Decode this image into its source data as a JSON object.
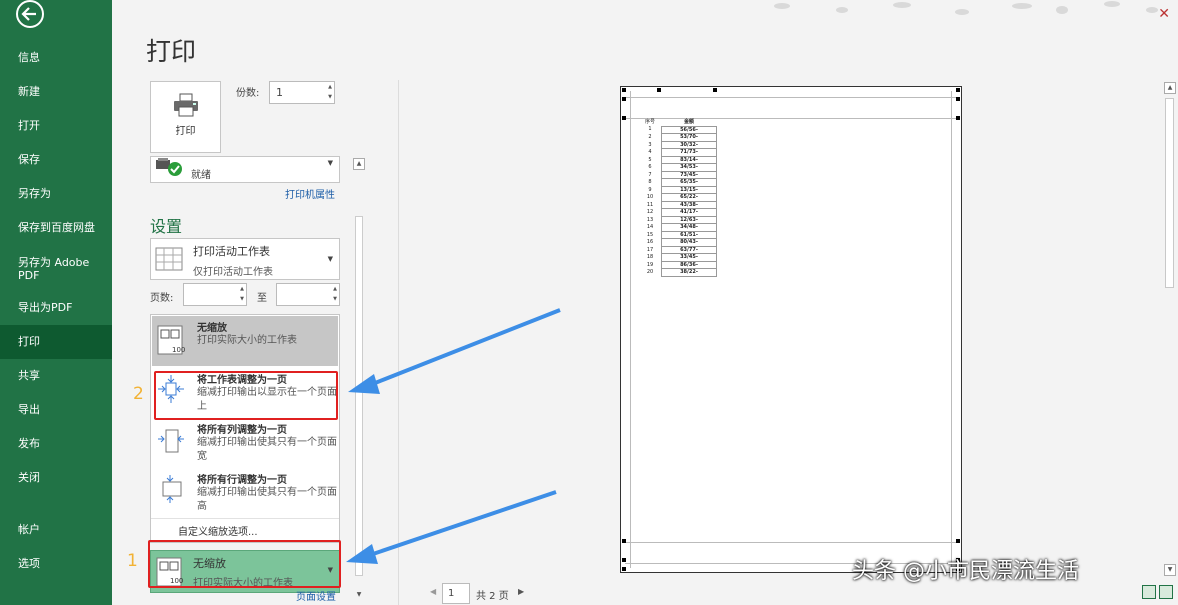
{
  "sidebar": {
    "items": [
      {
        "label": "信息"
      },
      {
        "label": "新建"
      },
      {
        "label": "打开"
      },
      {
        "label": "保存"
      },
      {
        "label": "另存为"
      },
      {
        "label": "保存到百度网盘"
      },
      {
        "label": "另存为 Adobe PDF"
      },
      {
        "label": "导出为PDF"
      },
      {
        "label": "打印"
      },
      {
        "label": "共享"
      },
      {
        "label": "导出"
      },
      {
        "label": "发布"
      },
      {
        "label": "关闭"
      },
      {
        "label": "帐户"
      },
      {
        "label": "选项"
      }
    ],
    "active": "打印",
    "colors": {
      "bg": "#217346",
      "active": "#0e5a30"
    }
  },
  "header": {
    "title": "打印"
  },
  "print": {
    "button_label": "打印",
    "copies_label": "份数:",
    "copies_value": "1"
  },
  "printer": {
    "status": "就绪",
    "properties_link": "打印机属性"
  },
  "settings": {
    "title": "设置",
    "print_what": {
      "title": "打印活动工作表",
      "desc": "仅打印活动工作表"
    },
    "pages_label": "页数:",
    "to_label": "至",
    "scaling_menu": [
      {
        "title": "无缩放",
        "desc": "打印实际大小的工作表"
      },
      {
        "title": "将工作表调整为一页",
        "desc": "缩减打印输出以显示在一个页面上"
      },
      {
        "title": "将所有列调整为一页",
        "desc": "缩减打印输出使其只有一个页面宽"
      },
      {
        "title": "将所有行调整为一页",
        "desc": "缩减打印输出使其只有一个页面高"
      }
    ],
    "custom_scaling": "自定义缩放选项...",
    "current_scaling": {
      "title": "无缩放",
      "desc": "打印实际大小的工作表"
    },
    "page_setup_link": "页面设置"
  },
  "annotations": {
    "num1": "1",
    "num2": "2"
  },
  "preview": {
    "header": [
      "序号",
      "金额"
    ],
    "rows": [
      [
        "1",
        "56/56-"
      ],
      [
        "2",
        "53/70-"
      ],
      [
        "3",
        "30/32-"
      ],
      [
        "4",
        "71/73-"
      ],
      [
        "5",
        "83/14-"
      ],
      [
        "6",
        "34/53-"
      ],
      [
        "7",
        "73/45-"
      ],
      [
        "8",
        "65/35-"
      ],
      [
        "9",
        "13/15-"
      ],
      [
        "10",
        "65/22-"
      ],
      [
        "11",
        "43/38-"
      ],
      [
        "12",
        "41/17-"
      ],
      [
        "13",
        "12/63-"
      ],
      [
        "14",
        "34/48-"
      ],
      [
        "15",
        "61/51-"
      ],
      [
        "16",
        "80/43-"
      ],
      [
        "17",
        "63/77-"
      ],
      [
        "18",
        "33/45-"
      ],
      [
        "19",
        "86/36-"
      ],
      [
        "20",
        "38/22-"
      ]
    ]
  },
  "pager": {
    "current": "1",
    "total_label": "共 2 页"
  },
  "watermark": "头条 @小市民漂流生活"
}
